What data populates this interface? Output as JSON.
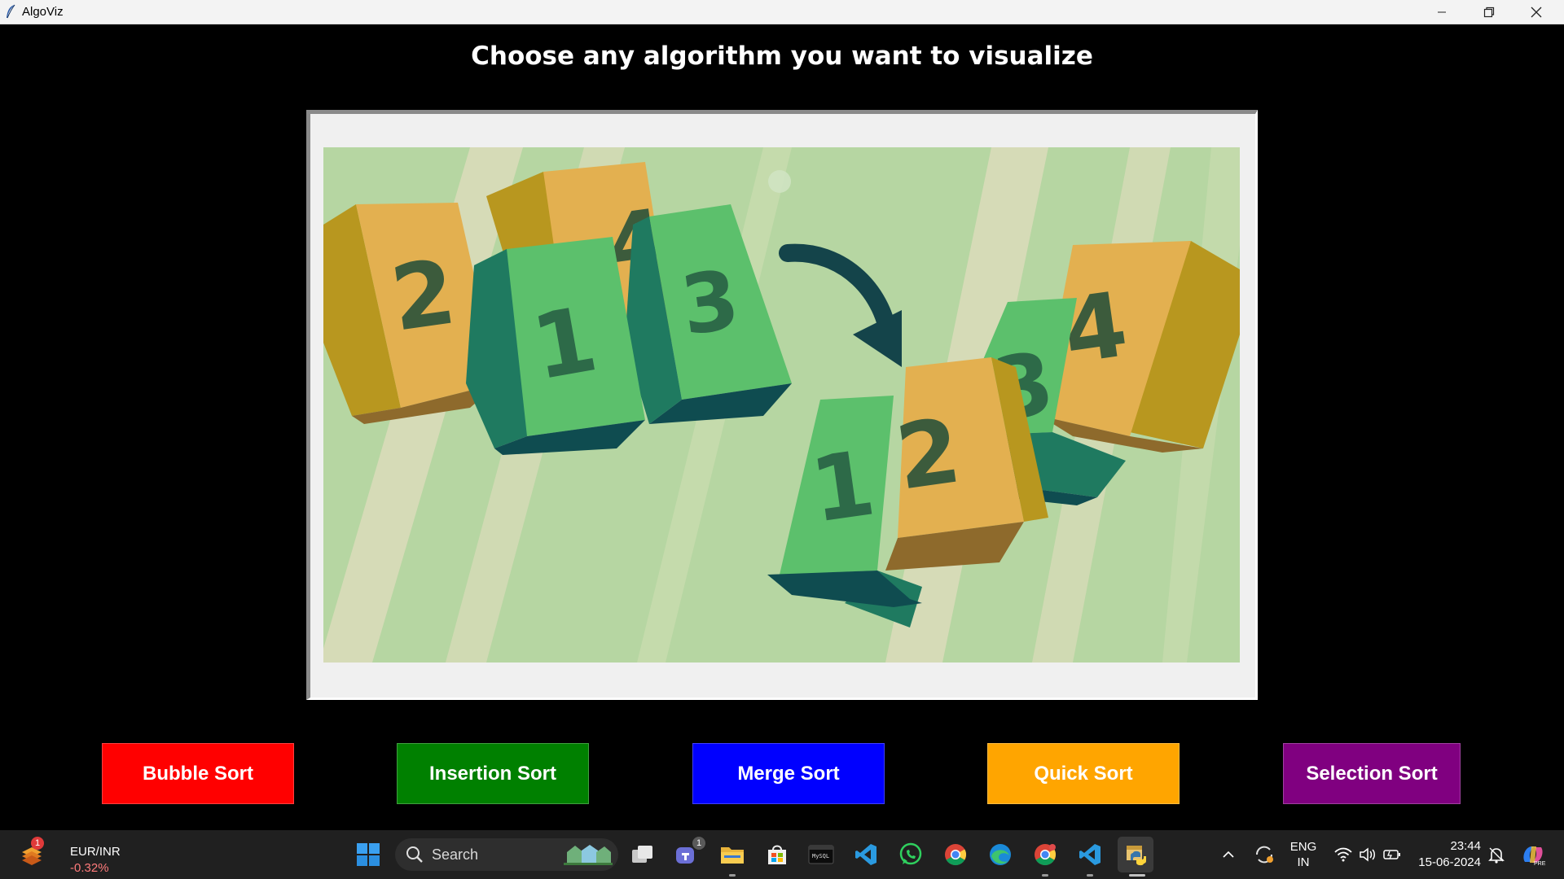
{
  "window": {
    "title": "AlgoViz",
    "controls": {
      "minimize_icon": "minimize-icon",
      "maximize_icon": "restore-icon",
      "close_icon": "close-icon"
    }
  },
  "main": {
    "heading": "Choose any algorithm you want to visualize",
    "image": {
      "unsorted_blocks": [
        "2",
        "1",
        "4",
        "3"
      ],
      "sorted_blocks": [
        "1",
        "2",
        "3",
        "4"
      ],
      "colors": {
        "background": "#b6d6a2",
        "orange_block": "#e3b050",
        "green_block": "#5cc06c",
        "arrow": "#14444a"
      }
    },
    "buttons": [
      {
        "label": "Bubble Sort",
        "color": "#ff0000"
      },
      {
        "label": "Insertion Sort",
        "color": "#008000"
      },
      {
        "label": "Merge Sort",
        "color": "#0000ff"
      },
      {
        "label": "Quick Sort",
        "color": "#ffa500"
      },
      {
        "label": "Selection Sort",
        "color": "#800080"
      }
    ]
  },
  "taskbar": {
    "widget": {
      "symbol": "EUR/INR",
      "change": "-0.32%",
      "badge": "1"
    },
    "search_placeholder": "Search",
    "teams_badge": "1",
    "apps": [
      "start-icon",
      "search-icon",
      "task-view-icon",
      "teams-icon",
      "file-explorer-icon",
      "store-icon",
      "terminal-icon",
      "vscode-icon",
      "whatsapp-icon",
      "chrome-icon",
      "edge-icon",
      "chrome-profile-icon",
      "vscode-insiders-icon",
      "python-icon"
    ],
    "tray": {
      "language_line1": "ENG",
      "language_line2": "IN",
      "time": "23:44",
      "date": "15-06-2024"
    }
  }
}
